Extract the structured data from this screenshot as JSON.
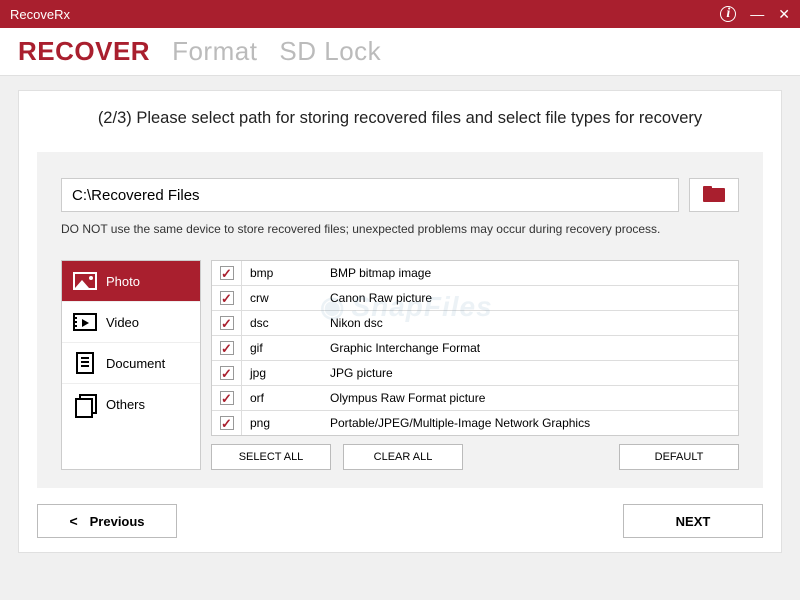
{
  "app": {
    "title": "RecoveRx"
  },
  "tabs": [
    {
      "label": "RECOVER",
      "active": true
    },
    {
      "label": "Format",
      "active": false
    },
    {
      "label": "SD Lock",
      "active": false
    }
  ],
  "step": {
    "instruction": "(2/3) Please select path for storing recovered files and select file types for recovery",
    "path_value": "C:\\Recovered Files",
    "warning": "DO NOT use the same device to store recovered files; unexpected problems may occur during recovery process."
  },
  "categories": [
    {
      "label": "Photo",
      "icon": "photo",
      "active": true
    },
    {
      "label": "Video",
      "icon": "video",
      "active": false
    },
    {
      "label": "Document",
      "icon": "doc",
      "active": false
    },
    {
      "label": "Others",
      "icon": "others",
      "active": false
    }
  ],
  "filetypes": [
    {
      "ext": "bmp",
      "desc": "BMP bitmap image",
      "checked": true
    },
    {
      "ext": "crw",
      "desc": "Canon Raw picture",
      "checked": true
    },
    {
      "ext": "dsc",
      "desc": "Nikon dsc",
      "checked": true
    },
    {
      "ext": "gif",
      "desc": "Graphic Interchange Format",
      "checked": true
    },
    {
      "ext": "jpg",
      "desc": "JPG picture",
      "checked": true
    },
    {
      "ext": "orf",
      "desc": "Olympus Raw Format picture",
      "checked": true
    },
    {
      "ext": "png",
      "desc": "Portable/JPEG/Multiple-Image Network Graphics",
      "checked": true
    }
  ],
  "buttons": {
    "select_all": "SELECT ALL",
    "clear_all": "CLEAR ALL",
    "default": "DEFAULT",
    "previous": "Previous",
    "next": "NEXT"
  },
  "watermark": "SnapFiles"
}
